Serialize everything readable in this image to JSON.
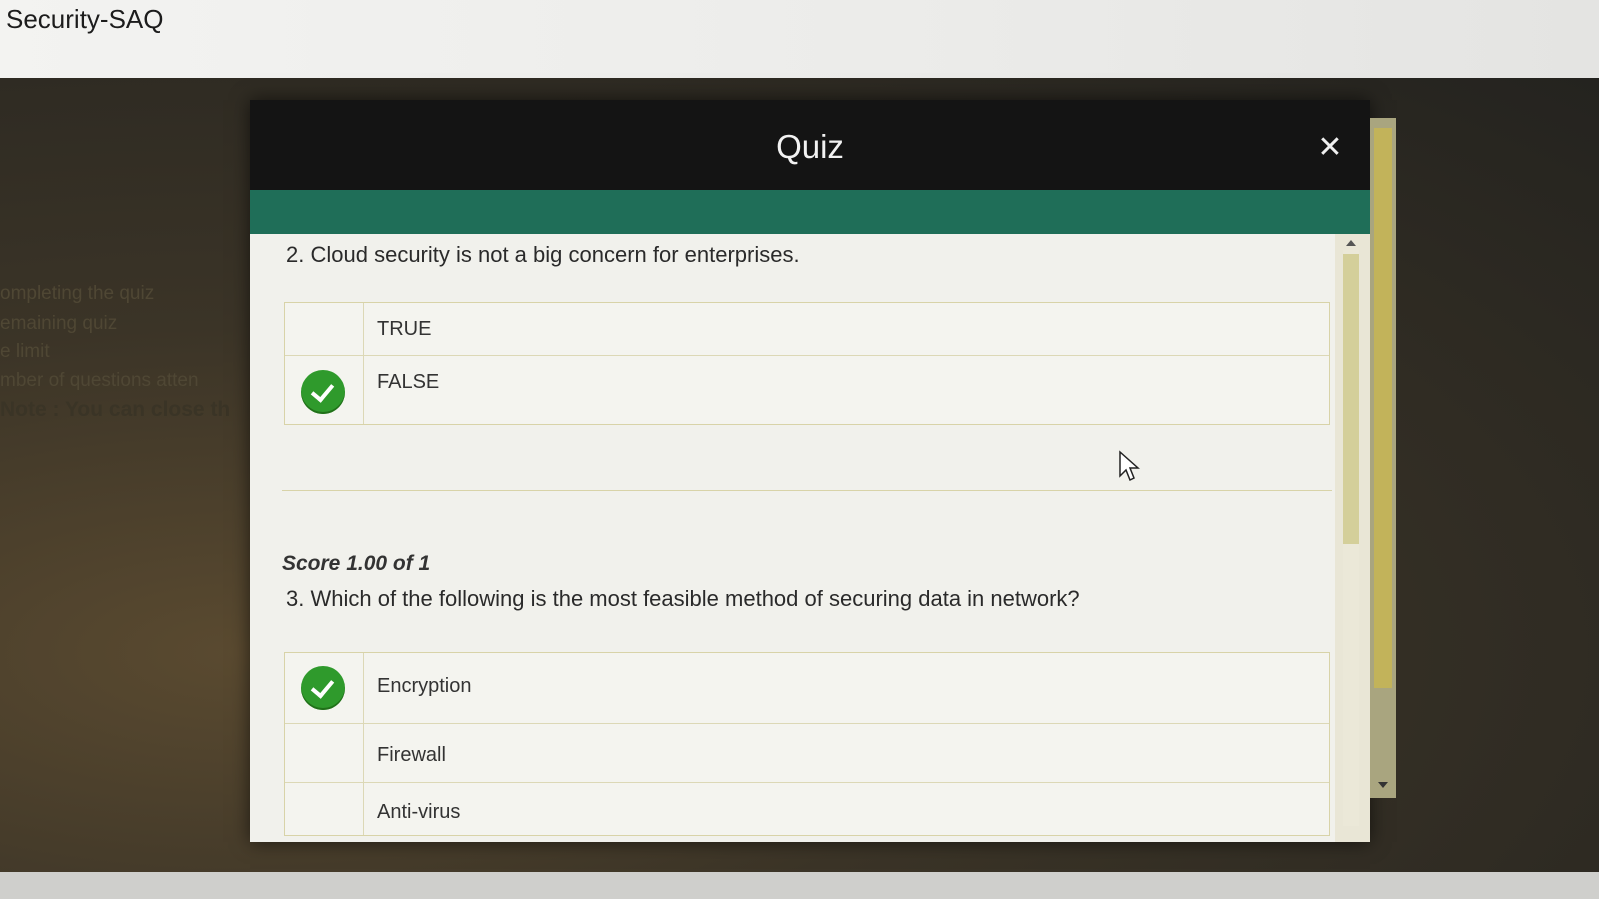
{
  "page": {
    "title": "Security-SAQ"
  },
  "background_text": [
    "ompleting the quiz",
    "emaining quiz",
    "e limit",
    "mber of questions atten",
    "Note : You can close th"
  ],
  "modal": {
    "title": "Quiz",
    "close_icon": "close-icon"
  },
  "questions": [
    {
      "number": "2.",
      "text": "Cloud security is not a big concern for enterprises.",
      "options": [
        {
          "label": "TRUE",
          "selected": false
        },
        {
          "label": "FALSE",
          "selected": true
        }
      ]
    },
    {
      "number": "3.",
      "text": "Which of the following is the most feasible method of securing data in network?",
      "options": [
        {
          "label": "Encryption",
          "selected": true
        },
        {
          "label": "Firewall",
          "selected": false
        },
        {
          "label": "Anti-virus",
          "selected": false
        }
      ]
    }
  ],
  "score": {
    "text": "Score 1.00 of 1"
  },
  "colors": {
    "header": "#141414",
    "progress_strip": "#1f6e58",
    "check": "#2f9a2c",
    "scrollbar_thumb": "#c2b35a"
  }
}
